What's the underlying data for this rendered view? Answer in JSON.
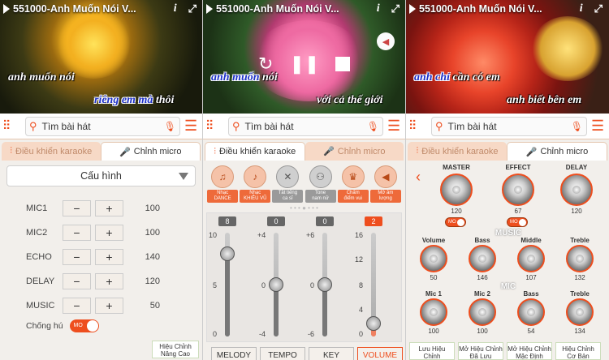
{
  "video": {
    "title1": "551000-Anh Muốn Nói V...",
    "title2": "551000-Anh Muốn Nói V...",
    "title3": "551000-Anh Muốn Nói V...",
    "l1a": "anh muốn nói",
    "l1b_hl": "riêng em mà",
    "l1b_rest": "thôi",
    "l2a_hl": "anh muốn",
    "l2a_rest": " nói",
    "l2b": "với cả thế giới",
    "l3a_hl": "anh chỉ",
    "l3a_rest": " cần có em",
    "l3b": "anh biết bên em"
  },
  "search": {
    "placeholder": "Tìm bài hát"
  },
  "tabs": {
    "karaoke": "Điều khiển karaoke",
    "micro": "Chỉnh micro"
  },
  "config": {
    "select": "Cấu hình",
    "rows": [
      {
        "label": "MIC1",
        "value": "100"
      },
      {
        "label": "MIC2",
        "value": "100"
      },
      {
        "label": "ECHO",
        "value": "140"
      },
      {
        "label": "DELAY",
        "value": "120"
      },
      {
        "label": "MUSIC",
        "value": "50"
      }
    ],
    "feedback_label": "Chống hú",
    "toggle": "MO",
    "hc1": "Hiệu Chỉnh",
    "hc2": "Nâng Cao"
  },
  "effects": [
    {
      "l1": "Nhạc",
      "l2": "DANCE"
    },
    {
      "l1": "Nhạc",
      "l2": "KHIÊU VŨ"
    },
    {
      "l1": "Tắt tiếng",
      "l2": "ca sĩ"
    },
    {
      "l1": "Tone",
      "l2": "nam nữ"
    },
    {
      "l1": "Chấm",
      "l2": "điểm vui"
    },
    {
      "l1": "Mở âm",
      "l2": "lượng"
    }
  ],
  "mixer": {
    "melody": {
      "label": "MELODY",
      "value": "8",
      "top": "10",
      "mid": "5",
      "bot": "0",
      "level": 0.8
    },
    "tempo": {
      "label": "TEMPO",
      "value": "0",
      "top": "+4",
      "mid": "0",
      "bot": "-4",
      "level": 0.5
    },
    "key": {
      "label": "KEY",
      "value": "0",
      "top": "+6",
      "mid": "0",
      "bot": "-6",
      "level": 0.5
    },
    "volume": {
      "label": "VOLUME",
      "value": "2",
      "t1": "16",
      "t2": "12",
      "t3": "8",
      "t4": "4",
      "bot": "0",
      "level": 0.125
    }
  },
  "micpanel": {
    "master": {
      "label": "MASTER",
      "value": "120"
    },
    "effect": {
      "label": "EFFECT",
      "value": "67"
    },
    "delay": {
      "label": "DELAY",
      "value": "120"
    },
    "toggle": "MO",
    "music_sec": "MUSIC",
    "mic_sec": "MIC",
    "music": [
      {
        "label": "Volume",
        "value": "50"
      },
      {
        "label": "Bass",
        "value": "146"
      },
      {
        "label": "Middle",
        "value": "107"
      },
      {
        "label": "Treble",
        "value": "132"
      }
    ],
    "mic": [
      {
        "label": "Mic 1",
        "value": "100"
      },
      {
        "label": "Mic 2",
        "value": "100"
      },
      {
        "label": "Bass",
        "value": "54"
      },
      {
        "label": "Treble",
        "value": "134"
      }
    ],
    "b1a": "Lưu Hiệu",
    "b1b": "Chỉnh",
    "b2a": "Mở Hiệu Chỉnh",
    "b2b": "Đã Lưu",
    "b3a": "Mở Hiệu Chỉnh",
    "b3b": "Mặc Định",
    "b4a": "Hiệu Chỉnh",
    "b4b": "Cơ Bản"
  },
  "colors": {
    "accent": "#ee4e1e",
    "bg": "#f2efeb"
  }
}
